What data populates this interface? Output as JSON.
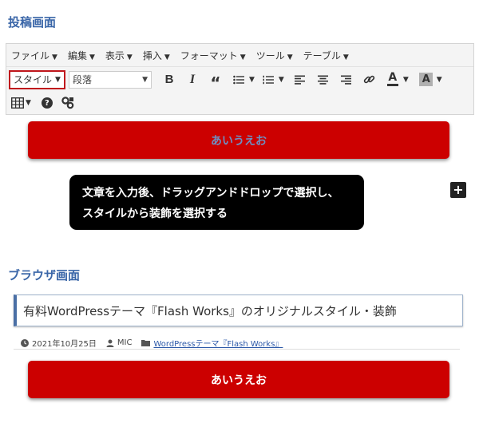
{
  "sections": {
    "editor_title": "投稿画面",
    "browser_title": "ブラウザ画面"
  },
  "menubar": {
    "items": [
      "ファイル",
      "編集",
      "表示",
      "挿入",
      "フォーマット",
      "ツール",
      "テーブル"
    ]
  },
  "toolbar": {
    "style_label": "スタイル",
    "format_label": "段落",
    "icons": [
      "bold-icon",
      "italic-icon",
      "blockquote-icon",
      "bullet-list-icon",
      "numbered-list-icon",
      "align-left-icon",
      "align-center-icon",
      "align-right-icon",
      "link-icon",
      "text-color-icon",
      "background-color-icon",
      "table-icon",
      "help-icon",
      "plugin-icon"
    ]
  },
  "editor": {
    "button_text": "あいうえお"
  },
  "tooltip": {
    "line1": "文章を入力後、ドラッグアンドドロップで選択し、",
    "line2": "スタイルから装飾を選択する"
  },
  "add_block_label": "+",
  "post": {
    "title": "有料WordPressテーマ『Flash Works』のオリジナルスタイル・装飾",
    "date": "2021年10月25日",
    "author": "MIC",
    "category": "WordPressテーマ『Flash Works』",
    "button_text": "あいうえお"
  },
  "colors": {
    "accent_red": "#cc0000",
    "title_blue": "#3a66a8",
    "style_select_border": "#c0161c"
  }
}
